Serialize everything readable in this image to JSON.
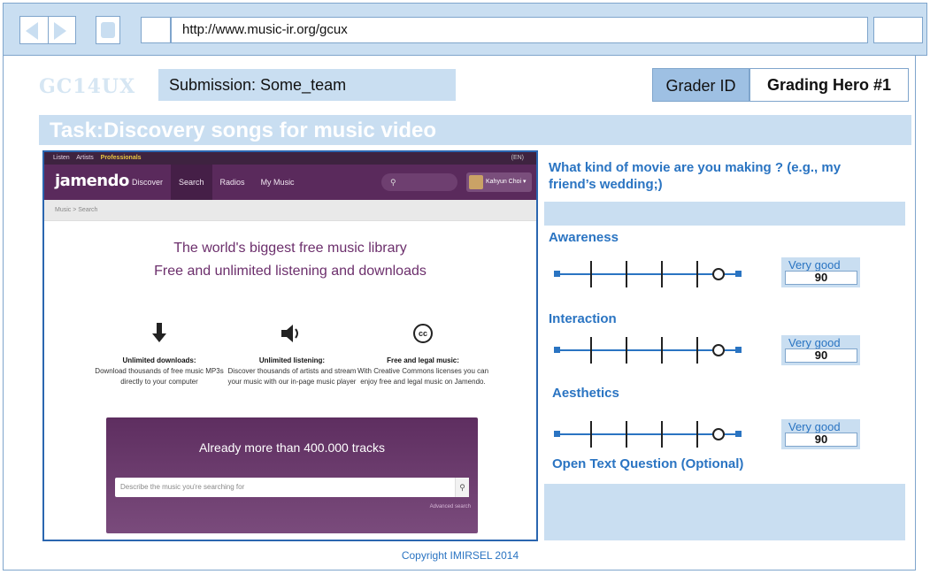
{
  "browser": {
    "url": "http://www.music-ir.org/gcux",
    "icons": [
      "back-arrow-icon",
      "forward-arrow-icon",
      "home-icon"
    ]
  },
  "header": {
    "logo": "GC14UX",
    "submission": "Submission: Some_team",
    "grader_label": "Grader ID",
    "grader_value": "Grading Hero #1"
  },
  "task": {
    "title": "Task:Discovery songs for music video"
  },
  "site": {
    "top_links": [
      "Listen",
      "Artists",
      "Professionals"
    ],
    "lang": "(EN)",
    "logo": "jamendo",
    "menu": [
      "Discover",
      "Search",
      "Radios",
      "My Music"
    ],
    "active_menu": "Search",
    "user": "Kahyun Choi",
    "breadcrumb": "Music > Search",
    "hero_line1": "The world's biggest free music library",
    "hero_line2": "Free and unlimited listening and downloads",
    "features": [
      {
        "icon": "download-icon",
        "title": "Unlimited downloads:",
        "text": "Download thousands of free music MP3s directly to your computer"
      },
      {
        "icon": "speaker-icon",
        "title": "Unlimited listening:",
        "text": "Discover thousands of artists and stream your music with our in-page music player"
      },
      {
        "icon": "creative-commons-icon",
        "title": "Free and legal music:",
        "text": "With Creative Commons licenses you can enjoy free and legal music on Jamendo."
      }
    ],
    "banner_title": "Already more than 400.000 tracks",
    "search_placeholder": "Describe the music you're searching for",
    "advanced_search": "Advanced search"
  },
  "questions": {
    "open_question": "What kind of movie are you making ? (e.g., my friend’s wedding;)",
    "sections": [
      {
        "title": "Awareness",
        "rating_label": "Very good",
        "rating_value": "90",
        "slider_level": 0.9
      },
      {
        "title": "Interaction",
        "rating_label": "Very good",
        "rating_value": "90",
        "slider_level": 0.9
      },
      {
        "title": "Aesthetics",
        "rating_label": "Very good",
        "rating_value": "90",
        "slider_level": 0.9
      }
    ],
    "open_text_title": "Open Text Question (Optional)"
  },
  "footer": {
    "copyright": "Copyright IMIRSEL 2014"
  },
  "colors": {
    "accent": "#2a74c2",
    "panel": "#c9def1",
    "jamendo_purple": "#5a2a5c"
  }
}
